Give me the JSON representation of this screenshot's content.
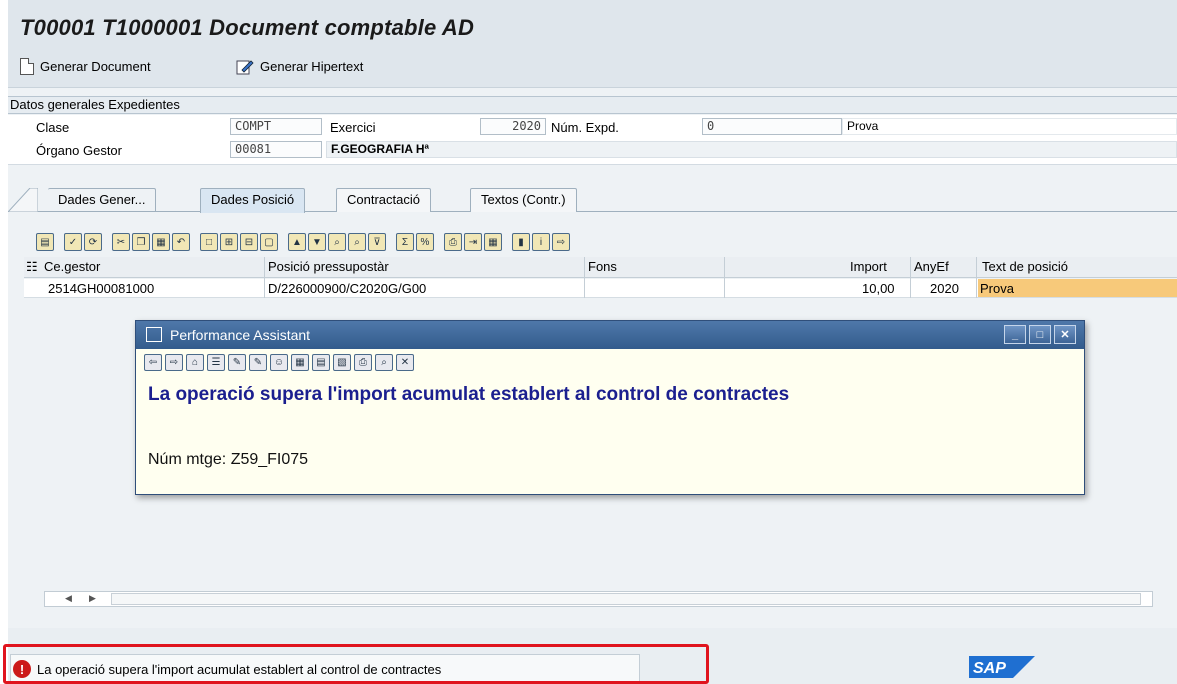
{
  "title": "T00001 T1000001 Document comptable AD",
  "toolbar": {
    "generar_document": "Generar Document",
    "generar_hipertext": "Generar Hipertext"
  },
  "section": {
    "heading": "Datos generales Expedientes"
  },
  "form": {
    "clase_label": "Clase",
    "clase_value": "COMPT",
    "exercici_label": "Exercici",
    "exercici_value": "2020",
    "num_expd_label": "Núm. Expd.",
    "num_expd_value": "0",
    "prova_text": "Prova",
    "organo_label": "Órgano Gestor",
    "organo_value": "00081",
    "organo_desc": "F.GEOGRAFIA Hª"
  },
  "tabs": [
    {
      "label": "Dades Gener..."
    },
    {
      "label": "Dades Posició",
      "active": true
    },
    {
      "label": "Contractació"
    },
    {
      "label": "Textos (Contr.)"
    }
  ],
  "grid": {
    "headers": {
      "ce_gestor": "Ce.gestor",
      "posicio": "Posició pressupostàr",
      "fons": "Fons",
      "import": "Import",
      "anyef": "AnyEf",
      "text": "Text de posició"
    },
    "rows": [
      {
        "ce_gestor": "2514GH00081000",
        "posicio": "D/226000900/C2020G/G00",
        "fons": "",
        "import": "10,00",
        "anyef": "2020",
        "text": "Prova"
      }
    ]
  },
  "popup": {
    "title": "Performance Assistant",
    "message": "La operació supera l'import acumulat establert al control de contractes",
    "msg_number": "Núm mtge: Z59_FI075"
  },
  "status": {
    "message": "La operació supera l'import acumulat establert al control de contractes"
  },
  "colors": {
    "title_bar": "#dfe6ec",
    "popup_header": "#335b8c",
    "popup_message": "#1b1f8f",
    "error_icon": "#cc1a1a",
    "highlight_box": "#e0141e",
    "row_highlight": "#f7c97a"
  }
}
